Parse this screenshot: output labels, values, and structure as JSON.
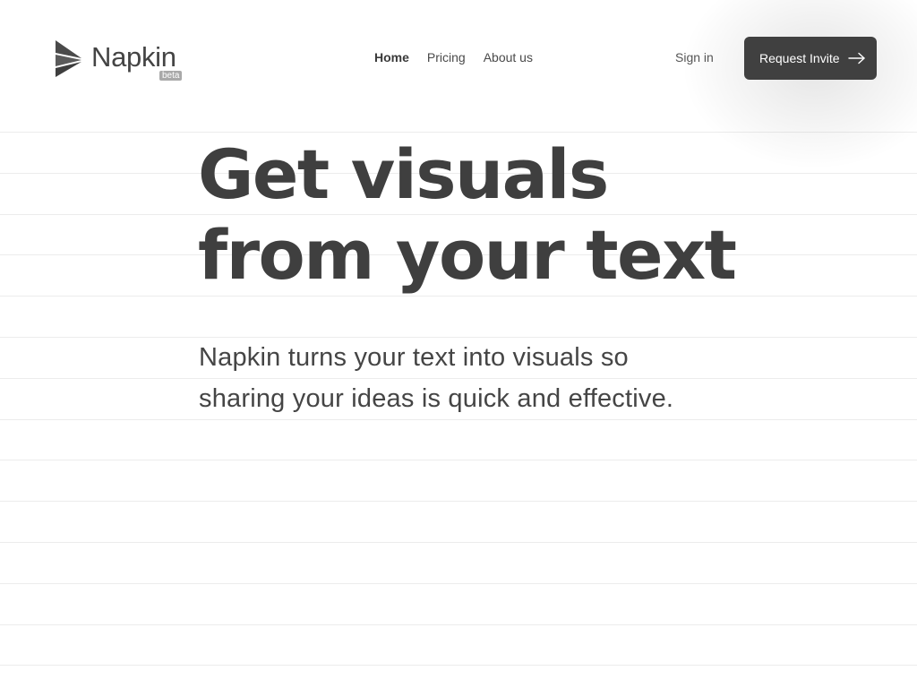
{
  "brand": {
    "name": "Napkin",
    "badge": "beta",
    "logo_icon": "napkin-logo-icon"
  },
  "nav": {
    "items": [
      {
        "label": "Home",
        "active": true
      },
      {
        "label": "Pricing",
        "active": false
      },
      {
        "label": "About us",
        "active": false
      }
    ]
  },
  "auth": {
    "sign_in_label": "Sign in",
    "cta_label": "Request Invite",
    "cta_icon": "arrow-right-icon"
  },
  "hero": {
    "title_line1": "Get visuals",
    "title_line2": "from your text",
    "subtitle": "Napkin turns your text into visuals so sharing your ideas is quick and effective."
  },
  "colors": {
    "background": "#ffffff",
    "text": "#3f3f3f",
    "cta_bg": "#404040",
    "cta_text": "#ffffff",
    "rule_line": "#ececec",
    "badge_bg": "#a9a9a9"
  }
}
